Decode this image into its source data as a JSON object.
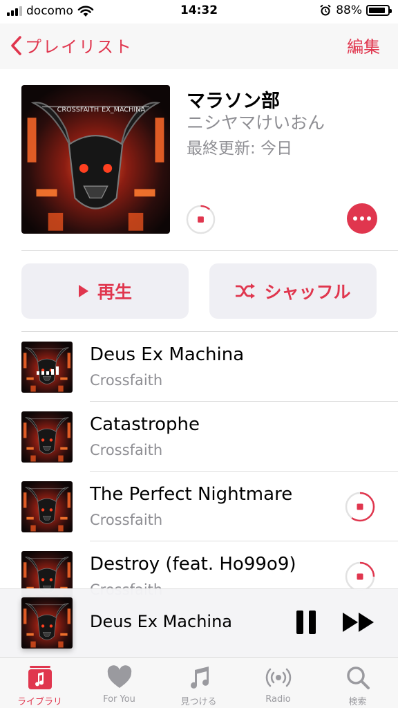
{
  "status_bar": {
    "carrier": "docomo",
    "time": "14:32",
    "battery": "88%",
    "battery_level": 0.88
  },
  "nav": {
    "back_label": "プレイリスト",
    "edit_label": "編集"
  },
  "playlist": {
    "title": "マラソン部",
    "curator": "ニシヤマけいおん",
    "updated": "最終更新: 今日",
    "artwork_text_left": "CROSSFAITH",
    "artwork_text_right": "EX_MACHINA"
  },
  "actions": {
    "play_label": "再生",
    "shuffle_label": "シャッフル"
  },
  "tracks": [
    {
      "title": "Deus Ex Machina",
      "artist": "Crossfaith",
      "state": "playing"
    },
    {
      "title": "Catastrophe",
      "artist": "Crossfaith",
      "state": "downloaded"
    },
    {
      "title": "The Perfect Nightmare",
      "artist": "Crossfaith",
      "state": "downloading",
      "progress": 0.6
    },
    {
      "title": "Destroy (feat. Ho99o9)",
      "artist": "Crossfaith",
      "state": "downloading",
      "progress": 0.25
    }
  ],
  "mini_player": {
    "title": "Deus Ex Machina"
  },
  "tabs": [
    {
      "label": "ライブラリ",
      "icon": "library-icon",
      "active": true
    },
    {
      "label": "For You",
      "icon": "heart-icon",
      "active": false
    },
    {
      "label": "見つける",
      "icon": "music-note-icon",
      "active": false
    },
    {
      "label": "Radio",
      "icon": "radio-icon",
      "active": false
    },
    {
      "label": "検索",
      "icon": "search-icon",
      "active": false
    }
  ],
  "colors": {
    "accent": "#e0364e",
    "secondary_text": "#8e8e93"
  }
}
